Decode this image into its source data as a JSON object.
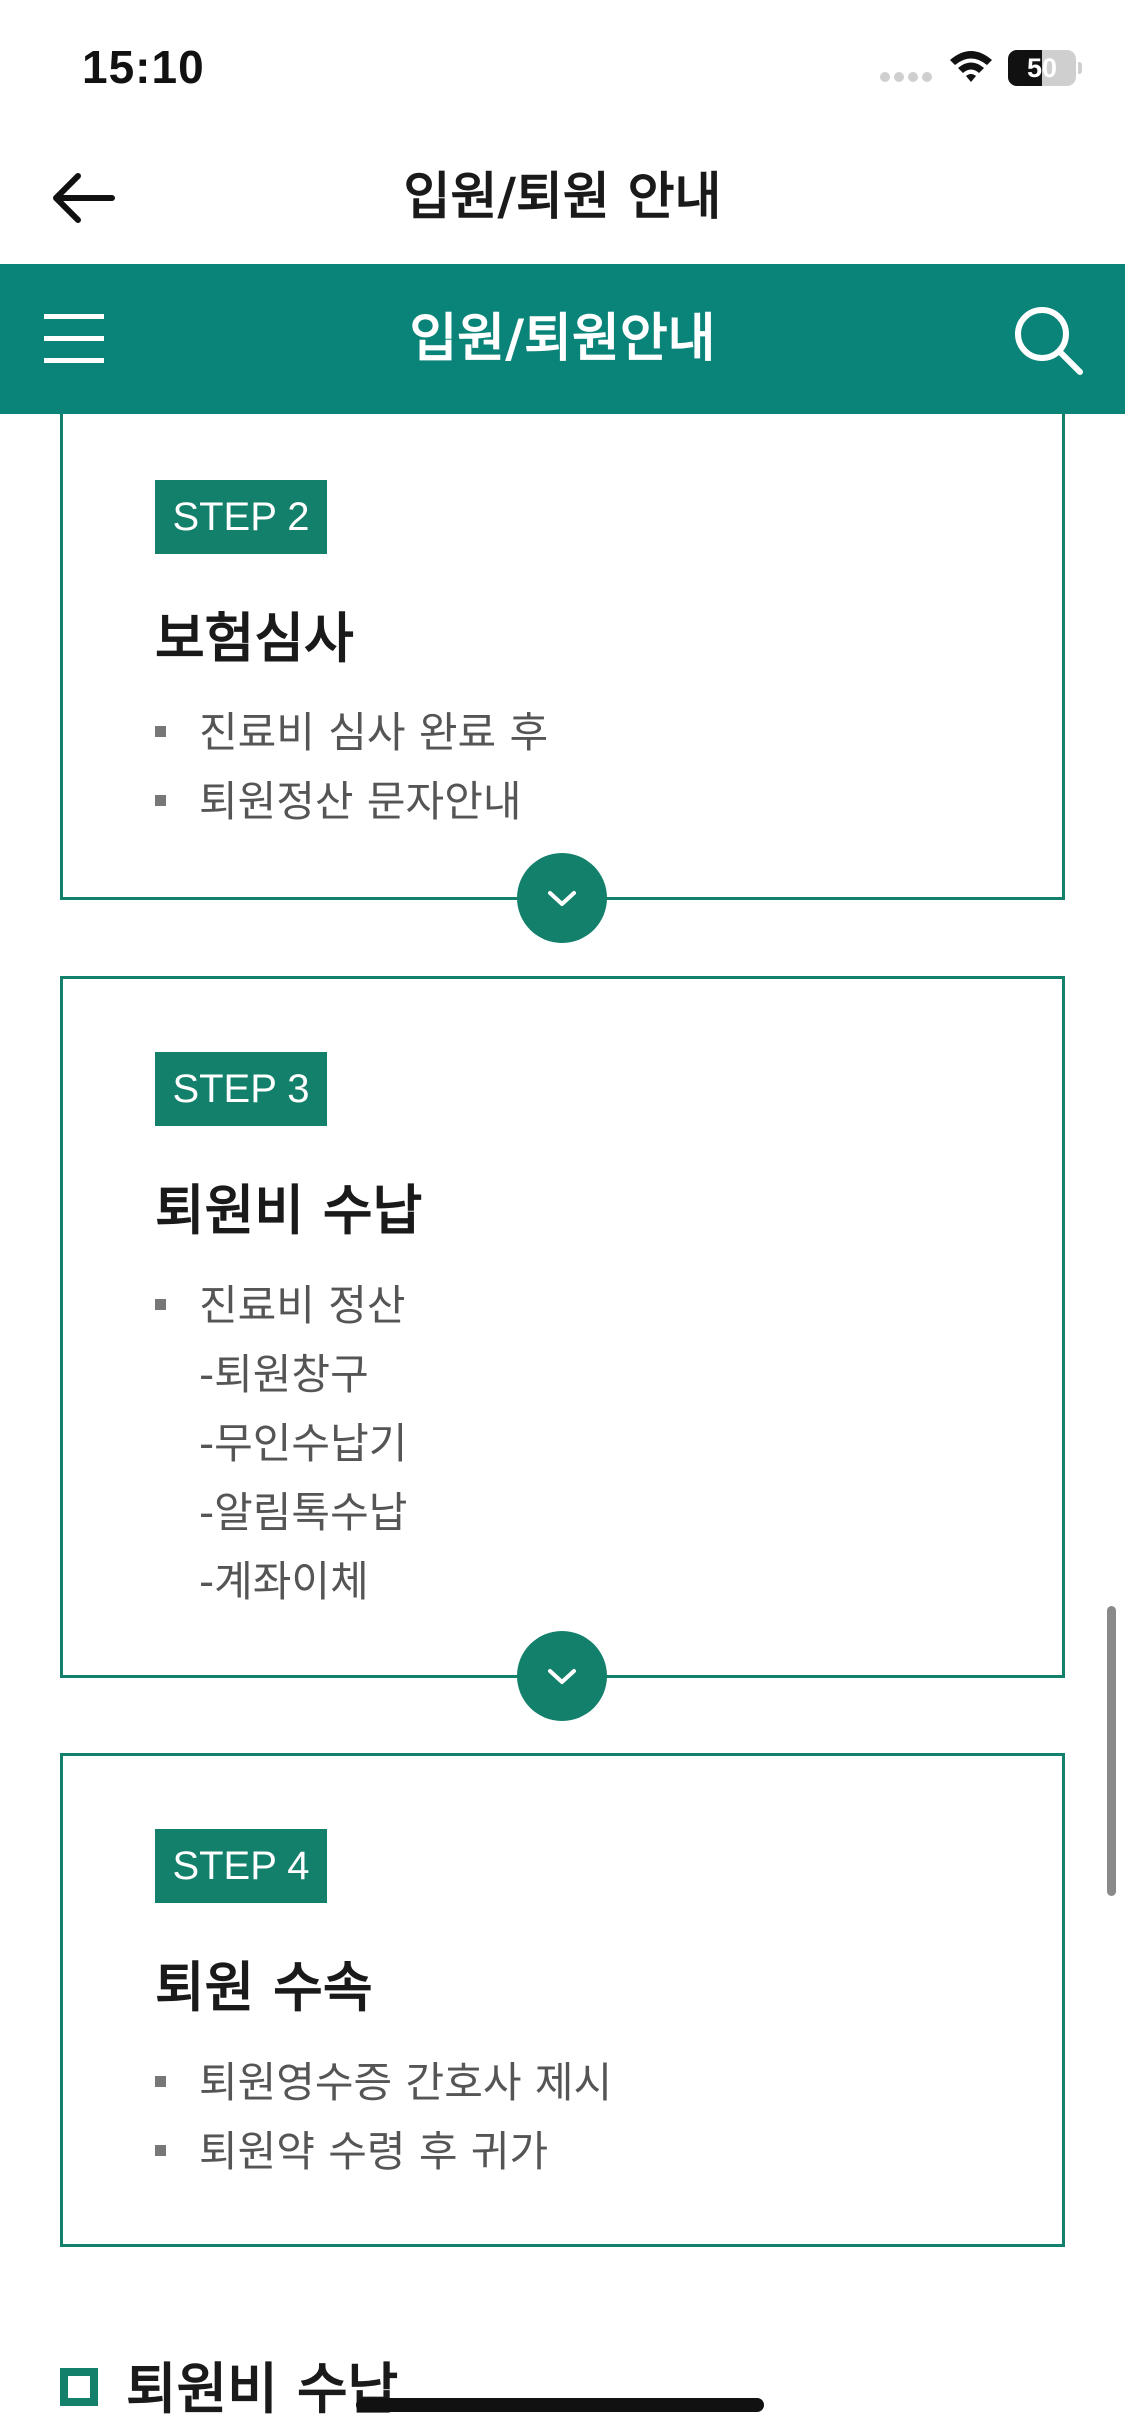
{
  "status_bar": {
    "time": "15:10",
    "battery": "50",
    "battery_level": 0.5
  },
  "header": {
    "back_icon": "arrow-left-icon",
    "title": "입원/퇴원 안내"
  },
  "nav": {
    "menu_icon": "hamburger-menu-icon",
    "title": "입원/퇴원안내",
    "search_icon": "search-icon",
    "background": "#0a8479"
  },
  "steps": [
    {
      "badge": "STEP 2",
      "title": "보험심사",
      "items": [
        "진료비 심사 완료 후",
        "퇴원정산 문자안내"
      ]
    },
    {
      "badge": "STEP 3",
      "title": "퇴원비 수납",
      "items": [
        "진료비 정산"
      ],
      "sub_items": [
        "-퇴원창구",
        "-무인수납기",
        "-알림톡수납",
        "-계좌이체"
      ]
    },
    {
      "badge": "STEP 4",
      "title": "퇴원 수속",
      "items": [
        "퇴원영수증 간호사 제시",
        "퇴원약 수령 후 귀가"
      ]
    }
  ],
  "section": {
    "title": "퇴원비 수납"
  },
  "colors": {
    "accent": "#12806a",
    "nav_green": "#0a8479",
    "text": "#1a1a1a",
    "muted_text": "#555555"
  }
}
